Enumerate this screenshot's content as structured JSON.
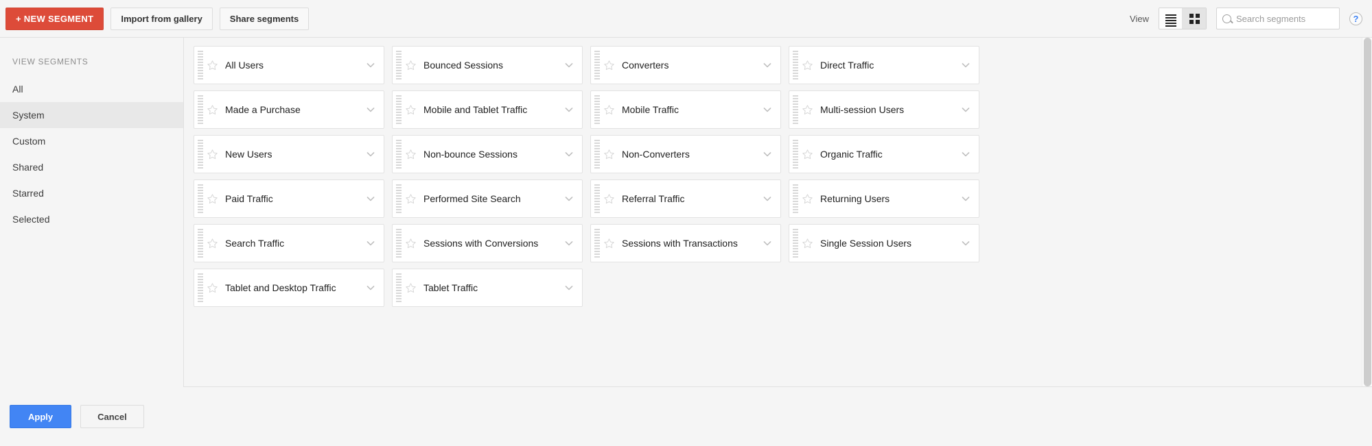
{
  "toolbar": {
    "new_segment_label": "+ NEW SEGMENT",
    "import_label": "Import from gallery",
    "share_label": "Share segments",
    "view_label": "View",
    "list_view_icon": "list-view-icon",
    "grid_view_icon": "grid-view-icon",
    "active_view": "grid",
    "search_placeholder": "Search segments",
    "search_value": "",
    "search_icon": "search-icon",
    "help_label": "?",
    "help_icon": "help-circle-icon"
  },
  "sidebar": {
    "heading": "VIEW SEGMENTS",
    "active": "System",
    "items": [
      {
        "label": "All"
      },
      {
        "label": "System"
      },
      {
        "label": "Custom"
      },
      {
        "label": "Shared"
      },
      {
        "label": "Starred"
      },
      {
        "label": "Selected"
      }
    ]
  },
  "segments": {
    "star_icon": "star-outline-icon",
    "expand_icon": "chevron-down-icon",
    "drag_icon": "drag-handle-icon",
    "items": [
      {
        "label": "All Users",
        "starred": false
      },
      {
        "label": "Bounced Sessions",
        "starred": false
      },
      {
        "label": "Converters",
        "starred": false
      },
      {
        "label": "Direct Traffic",
        "starred": false
      },
      {
        "label": "Made a Purchase",
        "starred": false
      },
      {
        "label": "Mobile and Tablet Traffic",
        "starred": false
      },
      {
        "label": "Mobile Traffic",
        "starred": false
      },
      {
        "label": "Multi-session Users",
        "starred": false
      },
      {
        "label": "New Users",
        "starred": false
      },
      {
        "label": "Non-bounce Sessions",
        "starred": false
      },
      {
        "label": "Non-Converters",
        "starred": false
      },
      {
        "label": "Organic Traffic",
        "starred": false
      },
      {
        "label": "Paid Traffic",
        "starred": false
      },
      {
        "label": "Performed Site Search",
        "starred": false
      },
      {
        "label": "Referral Traffic",
        "starred": false
      },
      {
        "label": "Returning Users",
        "starred": false
      },
      {
        "label": "Search Traffic",
        "starred": false
      },
      {
        "label": "Sessions with Conversions",
        "starred": false
      },
      {
        "label": "Sessions with Transactions",
        "starred": false
      },
      {
        "label": "Single Session Users",
        "starred": false
      },
      {
        "label": "Tablet and Desktop Traffic",
        "starred": false
      },
      {
        "label": "Tablet Traffic",
        "starred": false
      }
    ]
  },
  "footer": {
    "apply_label": "Apply",
    "cancel_label": "Cancel"
  },
  "colors": {
    "new_segment_red": "#dd4b39",
    "apply_blue": "#4285f4",
    "help_blue": "#4285f4",
    "page_bg": "#f5f5f5",
    "card_bg": "#ffffff",
    "sidebar_active_bg": "#e8e8e8"
  }
}
